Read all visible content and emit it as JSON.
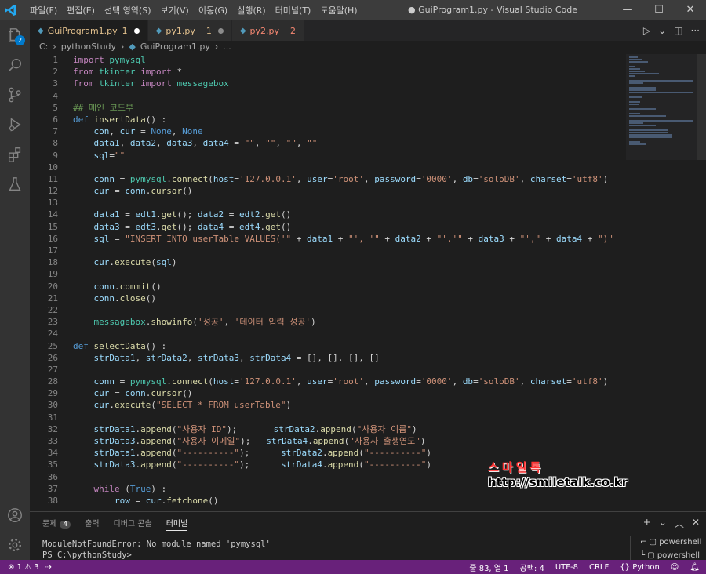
{
  "titlebar": {
    "menu": [
      "파일(F)",
      "편집(E)",
      "선택 영역(S)",
      "보기(V)",
      "이동(G)",
      "실행(R)",
      "터미널(T)",
      "도움말(H)"
    ],
    "window_title": "● GuiProgram1.py - Visual Studio Code"
  },
  "activity": {
    "explorer_badge": "2"
  },
  "tabs": [
    {
      "label": "GuiProgram1.py",
      "count": "1",
      "color": "#e2c08d"
    },
    {
      "label": "py1.py",
      "count": "1",
      "color": "#e2c08d"
    },
    {
      "label": "py2.py",
      "count": "2",
      "color": "#f48771"
    }
  ],
  "breadcrumb": [
    "C:",
    "›",
    "pythonStudy",
    "›",
    "GuiProgram1.py",
    "›",
    "..."
  ],
  "code_lines": [
    {
      "n": "1",
      "t": "import pymysql"
    },
    {
      "n": "2",
      "t": "from tkinter import *"
    },
    {
      "n": "3",
      "t": "from tkinter import messagebox"
    },
    {
      "n": "4",
      "t": ""
    },
    {
      "n": "5",
      "t": "## 메인 코드부"
    },
    {
      "n": "6",
      "t": "def insertData() :"
    },
    {
      "n": "7",
      "t": "    con, cur = None, None"
    },
    {
      "n": "8",
      "t": "    data1, data2, data3, data4 = \"\", \"\", \"\", \"\""
    },
    {
      "n": "9",
      "t": "    sql=\"\""
    },
    {
      "n": "10",
      "t": ""
    },
    {
      "n": "11",
      "t": "    conn = pymysql.connect(host='127.0.0.1', user='root', password='0000', db='soloDB', charset='utf8')"
    },
    {
      "n": "12",
      "t": "    cur = conn.cursor()"
    },
    {
      "n": "13",
      "t": ""
    },
    {
      "n": "14",
      "t": "    data1 = edt1.get(); data2 = edt2.get()"
    },
    {
      "n": "15",
      "t": "    data3 = edt3.get(); data4 = edt4.get()"
    },
    {
      "n": "16",
      "t": "    sql = \"INSERT INTO userTable VALUES('\" + data1 + \"', '\" + data2 + \"','\" + data3 + \"',\" + data4 + \")\""
    },
    {
      "n": "17",
      "t": ""
    },
    {
      "n": "18",
      "t": "    cur.execute(sql)"
    },
    {
      "n": "19",
      "t": ""
    },
    {
      "n": "20",
      "t": "    conn.commit()"
    },
    {
      "n": "21",
      "t": "    conn.close()"
    },
    {
      "n": "22",
      "t": ""
    },
    {
      "n": "23",
      "t": "    messagebox.showinfo('성공', '데이터 입력 성공')"
    },
    {
      "n": "24",
      "t": ""
    },
    {
      "n": "25",
      "t": "def selectData() :"
    },
    {
      "n": "26",
      "t": "    strData1, strData2, strData3, strData4 = [], [], [], []"
    },
    {
      "n": "27",
      "t": ""
    },
    {
      "n": "28",
      "t": "    conn = pymysql.connect(host='127.0.0.1', user='root', password='0000', db='soloDB', charset='utf8')"
    },
    {
      "n": "29",
      "t": "    cur = conn.cursor()"
    },
    {
      "n": "30",
      "t": "    cur.execute(\"SELECT * FROM userTable\")"
    },
    {
      "n": "31",
      "t": ""
    },
    {
      "n": "32",
      "t": "    strData1.append(\"사용자 ID\");       strData2.append(\"사용자 이름\")"
    },
    {
      "n": "33",
      "t": "    strData3.append(\"사용자 이메일\");   strData4.append(\"사용자 출생연도\")"
    },
    {
      "n": "34",
      "t": "    strData1.append(\"----------\");      strData2.append(\"----------\")"
    },
    {
      "n": "35",
      "t": "    strData3.append(\"----------\");      strData4.append(\"----------\")"
    },
    {
      "n": "36",
      "t": ""
    },
    {
      "n": "37",
      "t": "    while (True) :"
    },
    {
      "n": "38",
      "t": "        row = cur.fetchone()"
    }
  ],
  "watermark": {
    "line1": "스마일톡",
    "line2": "http://smiletalk.co.kr"
  },
  "panel": {
    "tabs": [
      {
        "label": "문제",
        "badge": "4"
      },
      {
        "label": "출력",
        "badge": ""
      },
      {
        "label": "디버그 콘솔",
        "badge": ""
      },
      {
        "label": "터미널",
        "badge": ""
      }
    ],
    "terminal_lines": [
      "ModuleNotFoundError: No module named 'pymysql'",
      "PS C:\\pythonStudy>"
    ],
    "shells": [
      "powershell",
      "powershell"
    ]
  },
  "statusbar": {
    "errors": "1",
    "warnings": "3",
    "position": "줄 83, 열 1",
    "spaces": "공백: 4",
    "encoding": "UTF-8",
    "eol": "CRLF",
    "language": "Python",
    "color": "#68217a"
  }
}
